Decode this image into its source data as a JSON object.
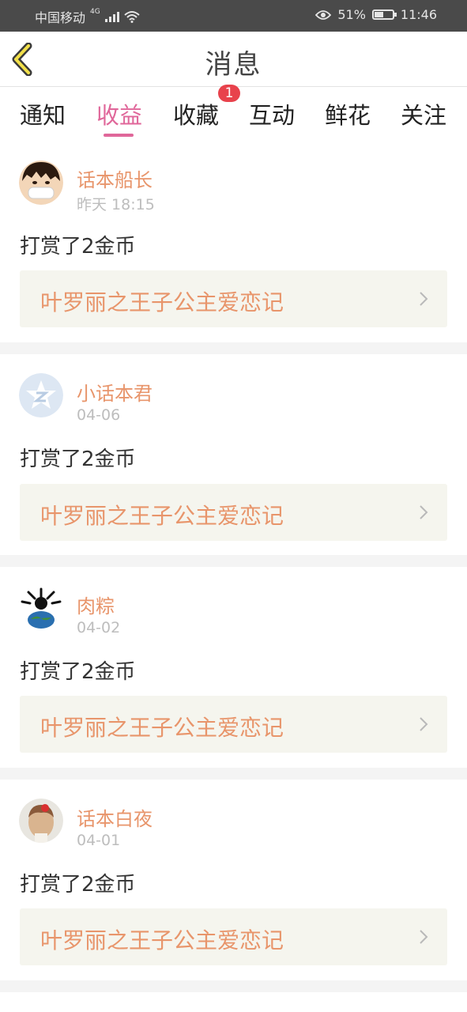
{
  "status_bar": {
    "carrier": "中国移动",
    "network": "4G",
    "battery": "51%",
    "time": "11:46"
  },
  "header": {
    "title": "消息",
    "back_icon": "chevron-left-icon"
  },
  "tabs": [
    {
      "label": "通知",
      "active": false
    },
    {
      "label": "收益",
      "active": true
    },
    {
      "label": "收藏",
      "active": false,
      "badge": "1"
    },
    {
      "label": "互动",
      "active": false
    },
    {
      "label": "鲜花",
      "active": false
    },
    {
      "label": "关注",
      "active": false
    }
  ],
  "messages": [
    {
      "user": "话本船长",
      "time": "昨天 18:15",
      "text": "打赏了2金币",
      "book": "叶罗丽之王子公主爱恋记",
      "avatar": "cartoon-boy-avatar"
    },
    {
      "user": "小话本君",
      "time": "04-06",
      "text": "打赏了2金币",
      "book": "叶罗丽之王子公主爱恋记",
      "avatar": "default-star-avatar"
    },
    {
      "user": "肉粽",
      "time": "04-02",
      "text": "打赏了2金币",
      "book": "叶罗丽之王子公主爱恋记",
      "avatar": "globe-avatar"
    },
    {
      "user": "话本白夜",
      "time": "04-01",
      "text": "打赏了2金币",
      "book": "叶罗丽之王子公主爱恋记",
      "avatar": "girl-photo-avatar"
    }
  ],
  "colors": {
    "accent": "#e0679a",
    "name": "#e8956b",
    "badge": "#e8424c"
  }
}
